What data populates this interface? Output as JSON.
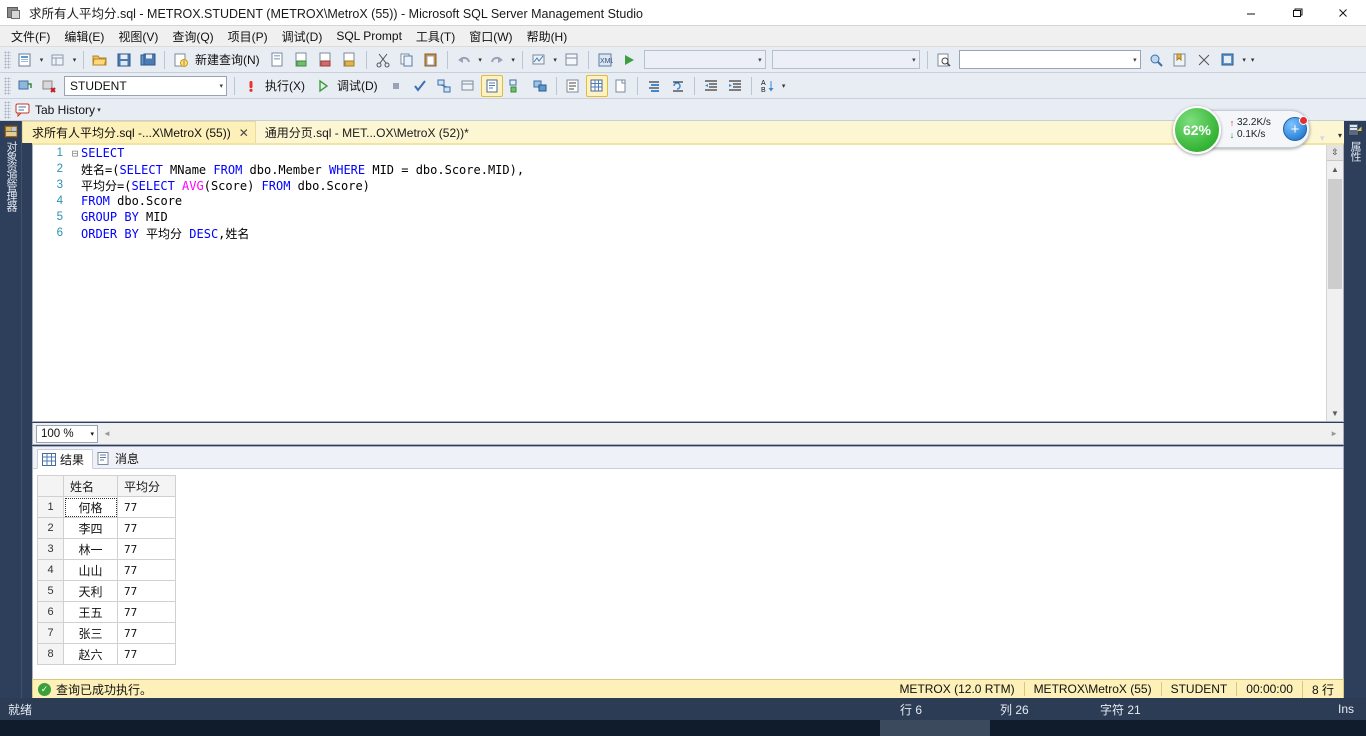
{
  "window": {
    "title": "求所有人平均分.sql - METROX.STUDENT (METROX\\MetroX (55)) - Microsoft SQL Server Management Studio",
    "minimize_label": "—",
    "maximize_label": "❐",
    "close_label": "✕"
  },
  "menu": {
    "items": [
      {
        "label": "文件(F)"
      },
      {
        "label": "编辑(E)"
      },
      {
        "label": "视图(V)"
      },
      {
        "label": "查询(Q)"
      },
      {
        "label": "项目(P)"
      },
      {
        "label": "调试(D)"
      },
      {
        "label": "SQL Prompt"
      },
      {
        "label": "工具(T)"
      },
      {
        "label": "窗口(W)"
      },
      {
        "label": "帮助(H)"
      }
    ]
  },
  "toolbar_main": {
    "new_query_label": "新建查询(N)",
    "combo1_value": "",
    "combo2_value": "",
    "combo3_value": "",
    "combo4_value": ""
  },
  "toolbar_sql": {
    "database_value": "STUDENT",
    "execute_label": "执行(X)",
    "debug_label": "调试(D)"
  },
  "tab_history": {
    "label": "Tab History"
  },
  "doc_tabs": [
    {
      "label": "求所有人平均分.sql -...X\\MetroX (55))",
      "active": true,
      "close": "✕"
    },
    {
      "label": "通用分页.sql - MET...OX\\MetroX (52))*",
      "active": false,
      "close": ""
    }
  ],
  "object_explorer": {
    "vertical_label": "对象资源管理器"
  },
  "right_dock": {
    "vertical_label": "属性"
  },
  "editor": {
    "zoom_value": "100 %",
    "lines": [
      {
        "no": "1",
        "fold": "⊟",
        "tokens": [
          {
            "t": "SELECT",
            "c": "kw"
          }
        ]
      },
      {
        "no": "2",
        "fold": "",
        "tokens": [
          {
            "t": "姓名=(",
            "c": "ident"
          },
          {
            "t": "SELECT",
            "c": "kw"
          },
          {
            "t": " MName ",
            "c": "ident"
          },
          {
            "t": "FROM",
            "c": "kw"
          },
          {
            "t": " dbo.Member ",
            "c": "ident"
          },
          {
            "t": "WHERE",
            "c": "kw"
          },
          {
            "t": " MID = dbo.Score.MID),",
            "c": "ident"
          }
        ]
      },
      {
        "no": "3",
        "fold": "",
        "tokens": [
          {
            "t": "平均分=(",
            "c": "ident"
          },
          {
            "t": "SELECT",
            "c": "kw"
          },
          {
            "t": " ",
            "c": "ident"
          },
          {
            "t": "AVG",
            "c": "fn"
          },
          {
            "t": "(Score) ",
            "c": "ident"
          },
          {
            "t": "FROM",
            "c": "kw"
          },
          {
            "t": " dbo.Score)",
            "c": "ident"
          }
        ]
      },
      {
        "no": "4",
        "fold": "",
        "tokens": [
          {
            "t": "FROM",
            "c": "kw"
          },
          {
            "t": " dbo.Score",
            "c": "ident"
          }
        ]
      },
      {
        "no": "5",
        "fold": "",
        "tokens": [
          {
            "t": "GROUP",
            "c": "kw"
          },
          {
            "t": " ",
            "c": "ident"
          },
          {
            "t": "BY",
            "c": "kw"
          },
          {
            "t": " MID",
            "c": "ident"
          }
        ]
      },
      {
        "no": "6",
        "fold": "",
        "tokens": [
          {
            "t": "ORDER",
            "c": "kw"
          },
          {
            "t": " ",
            "c": "ident"
          },
          {
            "t": "BY",
            "c": "kw"
          },
          {
            "t": " 平均分 ",
            "c": "ident"
          },
          {
            "t": "DESC",
            "c": "kw"
          },
          {
            "t": ",姓名",
            "c": "ident"
          }
        ]
      }
    ]
  },
  "results": {
    "tabs": [
      {
        "label": "结果",
        "active": true
      },
      {
        "label": "消息",
        "active": false
      }
    ],
    "columns": [
      "",
      "姓名",
      "平均分"
    ],
    "rows": [
      {
        "n": "1",
        "name": "何格",
        "avg": "77",
        "selected": true
      },
      {
        "n": "2",
        "name": "李四",
        "avg": "77",
        "selected": false
      },
      {
        "n": "3",
        "name": "林一",
        "avg": "77",
        "selected": false
      },
      {
        "n": "4",
        "name": "山山",
        "avg": "77",
        "selected": false
      },
      {
        "n": "5",
        "name": "天利",
        "avg": "77",
        "selected": false
      },
      {
        "n": "6",
        "name": "王五",
        "avg": "77",
        "selected": false
      },
      {
        "n": "7",
        "name": "张三",
        "avg": "77",
        "selected": false
      },
      {
        "n": "8",
        "name": "赵六",
        "avg": "77",
        "selected": false
      }
    ]
  },
  "query_status": {
    "message": "查询已成功执行。",
    "check_glyph": "✓",
    "server": "METROX (12.0 RTM)",
    "login": "METROX\\MetroX (55)",
    "database": "STUDENT",
    "elapsed": "00:00:00",
    "rows": "8 行"
  },
  "status_bar": {
    "ready": "就绪",
    "line": "行 6",
    "column": "列 26",
    "chars": "字符 21",
    "insert_mode": "Ins"
  },
  "net_widget": {
    "percent": "62%",
    "upload": "32.2K/s",
    "download": "0.1K/s",
    "up_arrow": "↑",
    "down_arrow": "↓",
    "plus": "+"
  },
  "taskbar": {
    "clock": ""
  },
  "colors": {
    "window_chrome": "#2e3f5c",
    "tab_strip": "#fdf6d2",
    "active_tab": "#fdf0b8",
    "status_yellow": "#fdf0b8",
    "keyword": "#0000ff",
    "function": "#ff00ff",
    "line_number": "#2b91af",
    "success_green": "#3aa03a"
  }
}
